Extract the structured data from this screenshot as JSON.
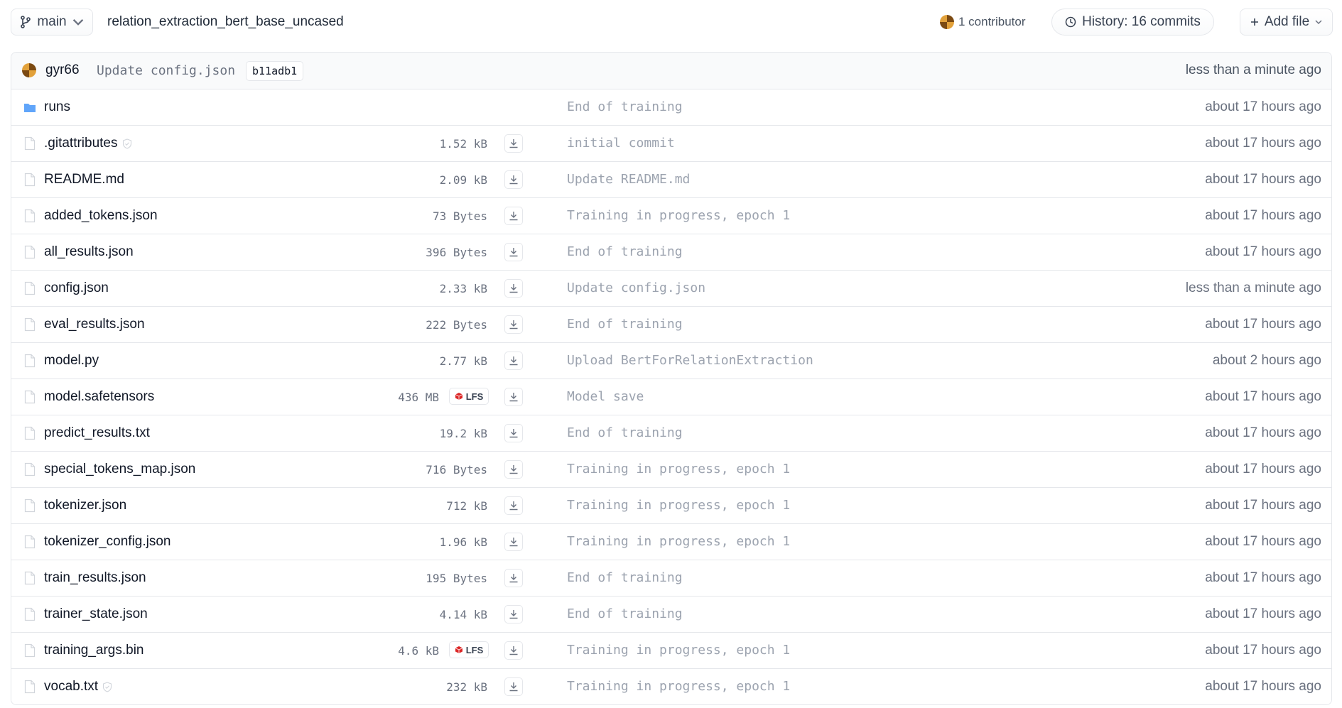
{
  "header": {
    "branch": "main",
    "repo_path": "relation_extraction_bert_base_uncased",
    "contributors": "1 contributor",
    "history": "History: 16 commits",
    "add_file": "Add file"
  },
  "last_commit": {
    "author": "gyr66",
    "message": "Update config.json",
    "hash": "b11adb1",
    "time": "less than a minute ago"
  },
  "files": [
    {
      "name": "runs",
      "type": "folder",
      "size": "",
      "lfs": false,
      "safe": false,
      "message": "End of training",
      "time": "about 17 hours ago"
    },
    {
      "name": ".gitattributes",
      "type": "file",
      "size": "1.52 kB",
      "lfs": false,
      "safe": true,
      "message": "initial commit",
      "time": "about 17 hours ago"
    },
    {
      "name": "README.md",
      "type": "file",
      "size": "2.09 kB",
      "lfs": false,
      "safe": false,
      "message": "Update README.md",
      "time": "about 17 hours ago"
    },
    {
      "name": "added_tokens.json",
      "type": "file",
      "size": "73 Bytes",
      "lfs": false,
      "safe": false,
      "message": "Training in progress, epoch 1",
      "time": "about 17 hours ago"
    },
    {
      "name": "all_results.json",
      "type": "file",
      "size": "396 Bytes",
      "lfs": false,
      "safe": false,
      "message": "End of training",
      "time": "about 17 hours ago"
    },
    {
      "name": "config.json",
      "type": "file",
      "size": "2.33 kB",
      "lfs": false,
      "safe": false,
      "message": "Update config.json",
      "time": "less than a minute ago"
    },
    {
      "name": "eval_results.json",
      "type": "file",
      "size": "222 Bytes",
      "lfs": false,
      "safe": false,
      "message": "End of training",
      "time": "about 17 hours ago"
    },
    {
      "name": "model.py",
      "type": "file",
      "size": "2.77 kB",
      "lfs": false,
      "safe": false,
      "message": "Upload BertForRelationExtraction",
      "time": "about 2 hours ago"
    },
    {
      "name": "model.safetensors",
      "type": "file",
      "size": "436 MB",
      "lfs": true,
      "safe": false,
      "message": "Model save",
      "time": "about 17 hours ago"
    },
    {
      "name": "predict_results.txt",
      "type": "file",
      "size": "19.2 kB",
      "lfs": false,
      "safe": false,
      "message": "End of training",
      "time": "about 17 hours ago"
    },
    {
      "name": "special_tokens_map.json",
      "type": "file",
      "size": "716 Bytes",
      "lfs": false,
      "safe": false,
      "message": "Training in progress, epoch 1",
      "time": "about 17 hours ago"
    },
    {
      "name": "tokenizer.json",
      "type": "file",
      "size": "712 kB",
      "lfs": false,
      "safe": false,
      "message": "Training in progress, epoch 1",
      "time": "about 17 hours ago"
    },
    {
      "name": "tokenizer_config.json",
      "type": "file",
      "size": "1.96 kB",
      "lfs": false,
      "safe": false,
      "message": "Training in progress, epoch 1",
      "time": "about 17 hours ago"
    },
    {
      "name": "train_results.json",
      "type": "file",
      "size": "195 Bytes",
      "lfs": false,
      "safe": false,
      "message": "End of training",
      "time": "about 17 hours ago"
    },
    {
      "name": "trainer_state.json",
      "type": "file",
      "size": "4.14 kB",
      "lfs": false,
      "safe": false,
      "message": "End of training",
      "time": "about 17 hours ago"
    },
    {
      "name": "training_args.bin",
      "type": "file",
      "size": "4.6 kB",
      "lfs": true,
      "safe": false,
      "message": "Training in progress, epoch 1",
      "time": "about 17 hours ago"
    },
    {
      "name": "vocab.txt",
      "type": "file",
      "size": "232 kB",
      "lfs": false,
      "safe": true,
      "message": "Training in progress, epoch 1",
      "time": "about 17 hours ago"
    }
  ],
  "lfs_label": "LFS",
  "colors": {
    "folder": "#60a5fa",
    "lfs_icon": "#dc2626",
    "border": "#e5e7eb",
    "muted": "#9ca3af"
  },
  "icons": {
    "branch": "git-branch-icon",
    "history": "clock-icon",
    "add": "plus-icon",
    "file": "file-icon",
    "folder": "folder-icon",
    "download": "download-icon",
    "safe": "shield-check-icon",
    "lfs": "lfs-cube-icon"
  }
}
